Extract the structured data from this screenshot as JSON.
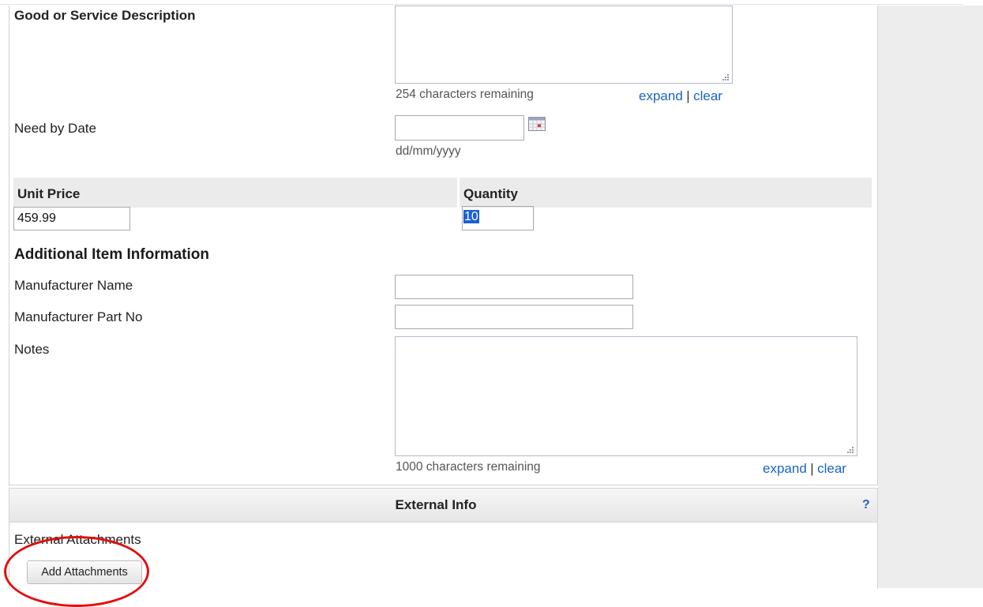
{
  "description_section": {
    "label": "Good or Service Description",
    "textarea_value": "",
    "chars_remaining": "254 characters remaining",
    "expand_label": "expand",
    "separator": "|",
    "clear_label": "clear"
  },
  "need_by_date": {
    "label": "Need by Date",
    "value": "",
    "format_hint": "dd/mm/yyyy",
    "icon": "calendar-icon"
  },
  "price_quantity": {
    "unit_price_header": "Unit Price",
    "unit_price_value": "459.99",
    "quantity_header": "Quantity",
    "quantity_value": "10"
  },
  "additional_info": {
    "heading": "Additional Item Information",
    "manufacturer_name_label": "Manufacturer Name",
    "manufacturer_name_value": "",
    "manufacturer_part_label": "Manufacturer Part No",
    "manufacturer_part_value": "",
    "notes_label": "Notes",
    "notes_value": "",
    "notes_chars_remaining": "1000 characters remaining",
    "expand_label": "expand",
    "separator": "|",
    "clear_label": "clear"
  },
  "external_info": {
    "header": "External Info",
    "help_label": "?",
    "attachments_label": "External Attachments",
    "add_attachments_button": "Add Attachments"
  },
  "colors": {
    "link": "#1a64c8",
    "highlight_circle": "#e11010",
    "selection": "#1a60d0"
  }
}
